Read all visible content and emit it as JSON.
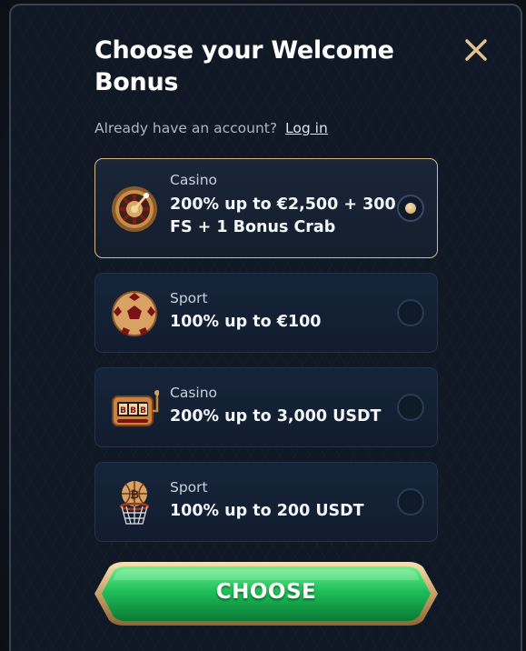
{
  "modal": {
    "title": "Choose your Welcome Bonus",
    "subtitle": "Already have an account?",
    "login_link": "Log in"
  },
  "options": [
    {
      "category": "Casino",
      "description": "200% up to €2,500 + 300 FS + 1 Bonus Crab",
      "icon": "roulette-icon",
      "selected": true
    },
    {
      "category": "Sport",
      "description": "100% up to €100",
      "icon": "soccer-ball-icon",
      "selected": false
    },
    {
      "category": "Casino",
      "description": "200% up to 3,000 USDT",
      "icon": "slot-machine-icon",
      "selected": false
    },
    {
      "category": "Sport",
      "description": "100% up to 200 USDT",
      "icon": "basketball-hoop-icon",
      "selected": false
    }
  ],
  "cta": {
    "label": "CHOOSE"
  },
  "colors": {
    "accent_gold": "#d7b88a",
    "cta_green": "#1fbf5a",
    "background": "#0f1824"
  }
}
